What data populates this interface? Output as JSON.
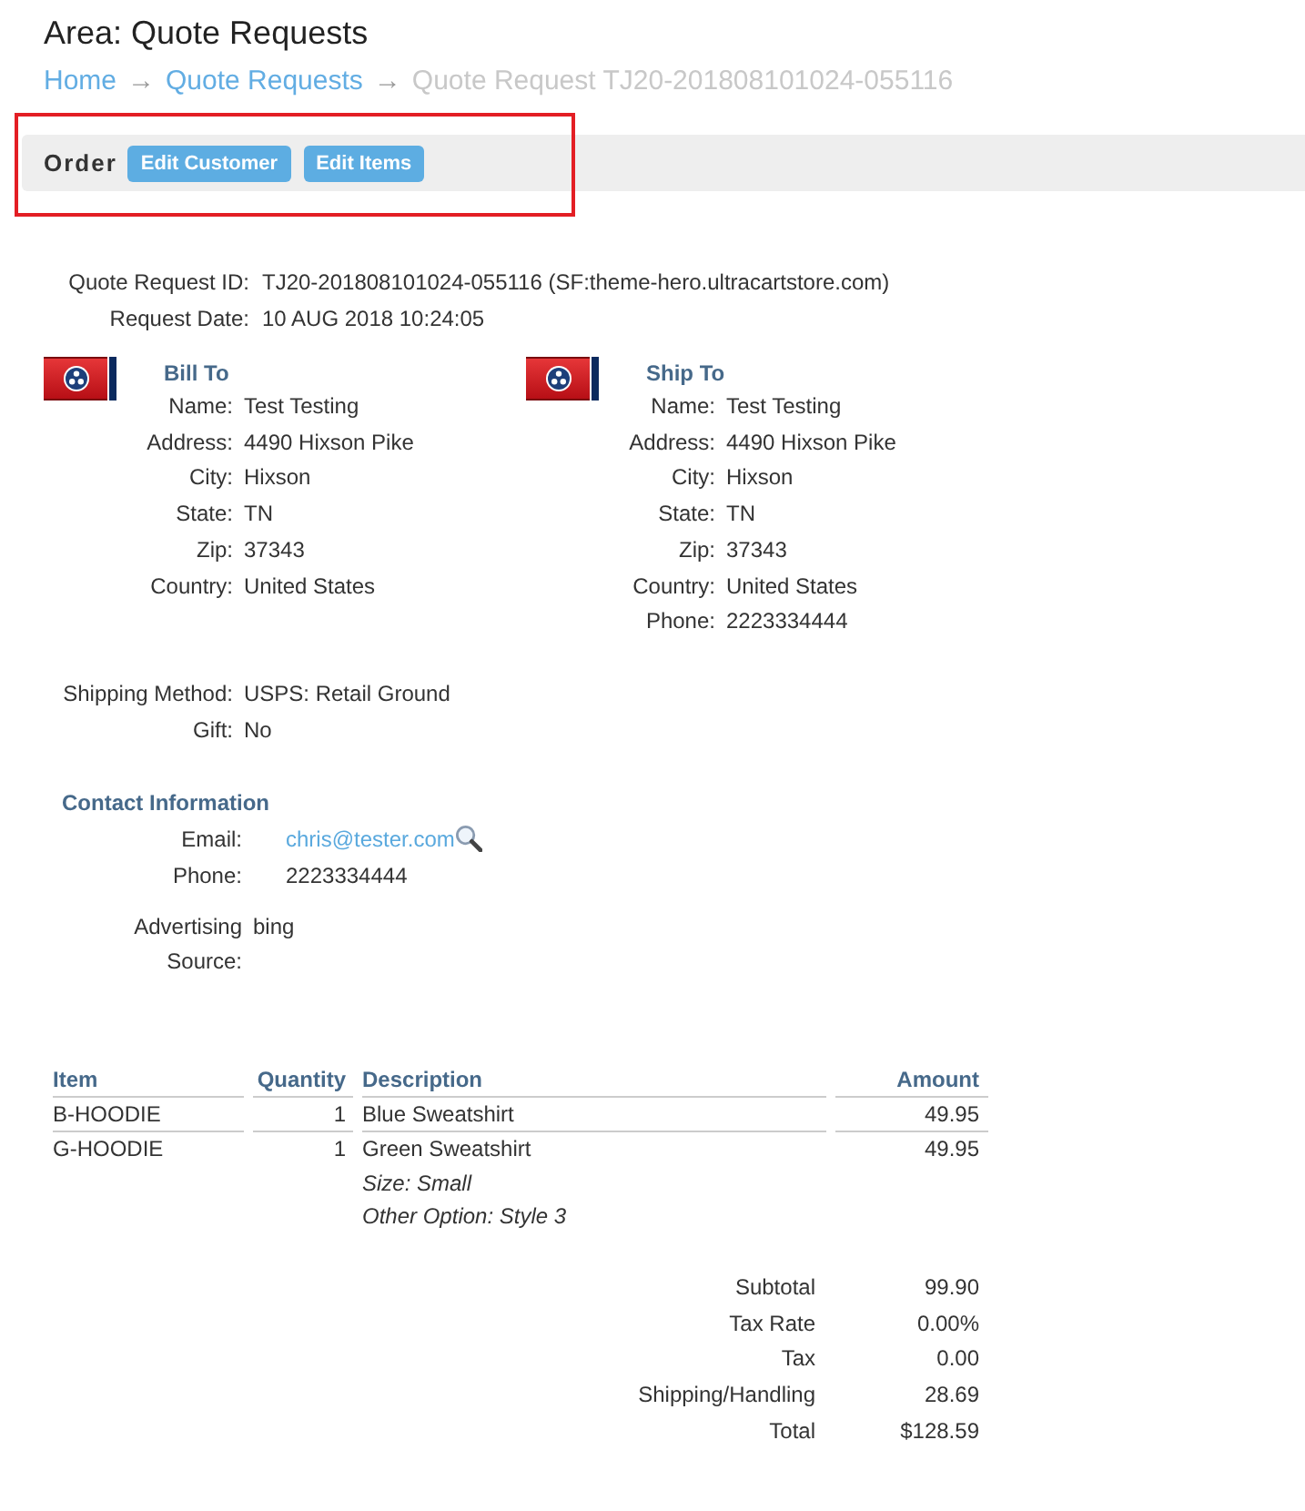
{
  "page_title": "Area: Quote Requests",
  "breadcrumb": [
    {
      "kind": "link",
      "label": "Home"
    },
    {
      "kind": "separator",
      "label": "→"
    },
    {
      "kind": "link",
      "label": "Quote Requests"
    },
    {
      "kind": "separator",
      "label": "→"
    },
    {
      "kind": "current",
      "label": "Quote Request TJ20-201808101024-055116"
    }
  ],
  "toolbar": {
    "label": "Order",
    "highlighted": true,
    "buttons": [
      "Edit Customer",
      "Edit Items"
    ]
  },
  "summary": [
    {
      "label": "Quote Request ID:",
      "value": "TJ20-201808101024-055116 (SF:theme-hero.ultracartstore.com)"
    },
    {
      "label": "Request Date:",
      "value": "10 AUG 2018 10:24:05"
    }
  ],
  "addresses": [
    {
      "heading": "Bill To",
      "fields": [
        {
          "label": "Name:",
          "value": "Test Testing"
        },
        {
          "label": "Address:",
          "value": "4490 Hixson Pike"
        },
        {
          "label": "City:",
          "value": "Hixson"
        },
        {
          "label": "State:",
          "value": "TN"
        },
        {
          "label": "Zip:",
          "value": "37343"
        },
        {
          "label": "Country:",
          "value": "United States"
        }
      ]
    },
    {
      "heading": "Ship To",
      "fields": [
        {
          "label": "Name:",
          "value": "Test Testing"
        },
        {
          "label": "Address:",
          "value": "4490 Hixson Pike"
        },
        {
          "label": "City:",
          "value": "Hixson"
        },
        {
          "label": "State:",
          "value": "TN"
        },
        {
          "label": "Zip:",
          "value": "37343"
        },
        {
          "label": "Country:",
          "value": "United States"
        },
        {
          "label": "Phone:",
          "value": "2223334444"
        }
      ]
    }
  ],
  "shipping": [
    {
      "label": "Shipping Method:",
      "value": "USPS: Retail Ground"
    },
    {
      "label": "Gift:",
      "value": "No"
    }
  ],
  "contact": {
    "heading": "Contact Information",
    "fields": [
      {
        "kind": "email",
        "label": "Email:",
        "value": "chris@tester.com"
      },
      {
        "kind": "text",
        "label": "Phone:",
        "value": "2223334444"
      }
    ]
  },
  "advertising": {
    "label": "Advertising Source:",
    "value": "bing"
  },
  "items_table": {
    "columns": [
      "Item",
      "Quantity",
      "Description",
      "Amount"
    ],
    "rows": [
      {
        "item": "B-HOODIE",
        "quantity": "1",
        "description": "Blue Sweatshirt",
        "amount": "49.95"
      },
      {
        "item": "G-HOODIE",
        "quantity": "1",
        "description": "Green Sweatshirt",
        "options": [
          "Size: Small",
          "Other Option: Style 3"
        ],
        "amount": "49.95"
      }
    ]
  },
  "totals": [
    {
      "label": "Subtotal",
      "value": "99.90"
    },
    {
      "label": "Tax Rate",
      "value": "0.00%"
    },
    {
      "label": "Tax",
      "value": "0.00"
    },
    {
      "label": "Shipping/Handling",
      "value": "28.69"
    },
    {
      "label": "Total",
      "value": "$128.59"
    }
  ]
}
